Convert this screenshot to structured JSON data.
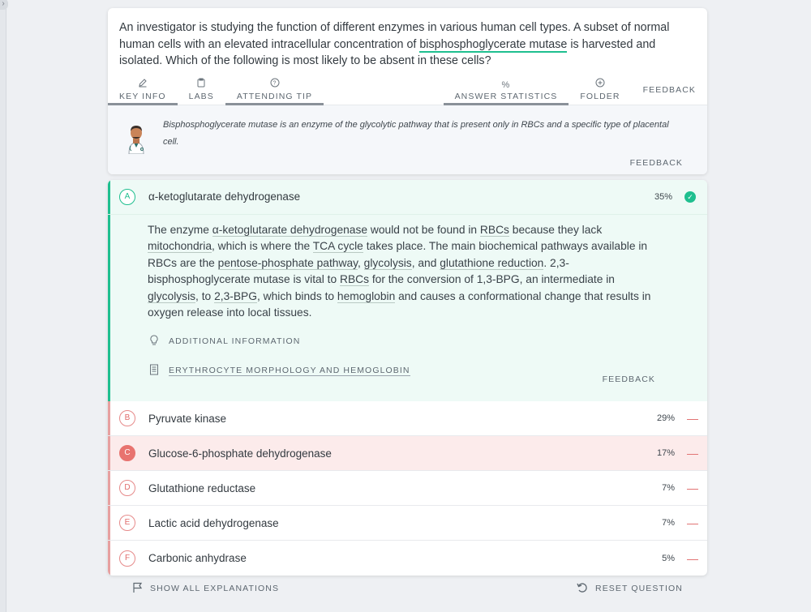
{
  "question": {
    "stem_before": "An investigator is studying the function of different enzymes in various human cell types. A subset of normal human cells with an elevated intracellular concentration of ",
    "stem_highlight": "bisphosphoglycerate mutase",
    "stem_after": " is harvested and isolated. Which of the following is most likely to be absent in these cells?"
  },
  "toolbar": {
    "key_info": "KEY INFO",
    "labs": "LABS",
    "attending_tip": "ATTENDING TIP",
    "answer_statistics": "ANSWER STATISTICS",
    "folder": "FOLDER",
    "feedback": "FEEDBACK"
  },
  "tip": {
    "text": "Bisphosphoglycerate mutase is an enzyme of the glycolytic pathway that is present only in RBCs and a specific type of placental cell.",
    "feedback": "FEEDBACK"
  },
  "answers": [
    {
      "letter": "A",
      "label": "α-ketoglutarate dehydrogenase",
      "pct": "35%"
    },
    {
      "letter": "B",
      "label": "Pyruvate kinase",
      "pct": "29%"
    },
    {
      "letter": "C",
      "label": "Glucose-6-phosphate dehydrogenase",
      "pct": "17%"
    },
    {
      "letter": "D",
      "label": "Glutathione reductase",
      "pct": "7%"
    },
    {
      "letter": "E",
      "label": "Lactic acid dehydrogenase",
      "pct": "7%"
    },
    {
      "letter": "F",
      "label": "Carbonic anhydrase",
      "pct": "5%"
    }
  ],
  "explanation": {
    "t1": "The enzyme ",
    "u1": "α-ketoglutarate dehydrogenase",
    "t2": " would not be found in ",
    "u2": "RBCs",
    "t3": " because they lack ",
    "u3": "mitochondria",
    "t4": ", which is where the ",
    "u4": "TCA cycle",
    "t5": " takes place. The main biochemical pathways available in RBCs are the ",
    "u5": "pentose-phosphate pathway",
    "t6": ", ",
    "u6": "glycolysis",
    "t7": ", and ",
    "u7": "glutathione reduction",
    "t8": ". 2,3-bisphosphoglycerate mutase is vital to ",
    "u8": "RBCs",
    "t9": " for the conversion of 1,3-BPG, an intermediate in ",
    "u9": "glycolysis",
    "t10": ", to ",
    "u10": "2,3-BPG",
    "t11": ", which binds to ",
    "u11": "hemoglobin",
    "t12": " and causes a conformational change that results in oxygen release into local tissues.",
    "additional_info": "ADDITIONAL INFORMATION",
    "article_link": "ERYTHROCYTE MORPHOLOGY AND HEMOGLOBIN",
    "feedback": "FEEDBACK"
  },
  "footer": {
    "show_all": "SHOW ALL EXPLANATIONS",
    "reset": "RESET QUESTION"
  },
  "colors": {
    "correct": "#1fbf8f",
    "incorrect": "#e06b6b",
    "selected_bg": "#fcebeb"
  },
  "icons": {
    "sidebar_toggle": "›"
  }
}
